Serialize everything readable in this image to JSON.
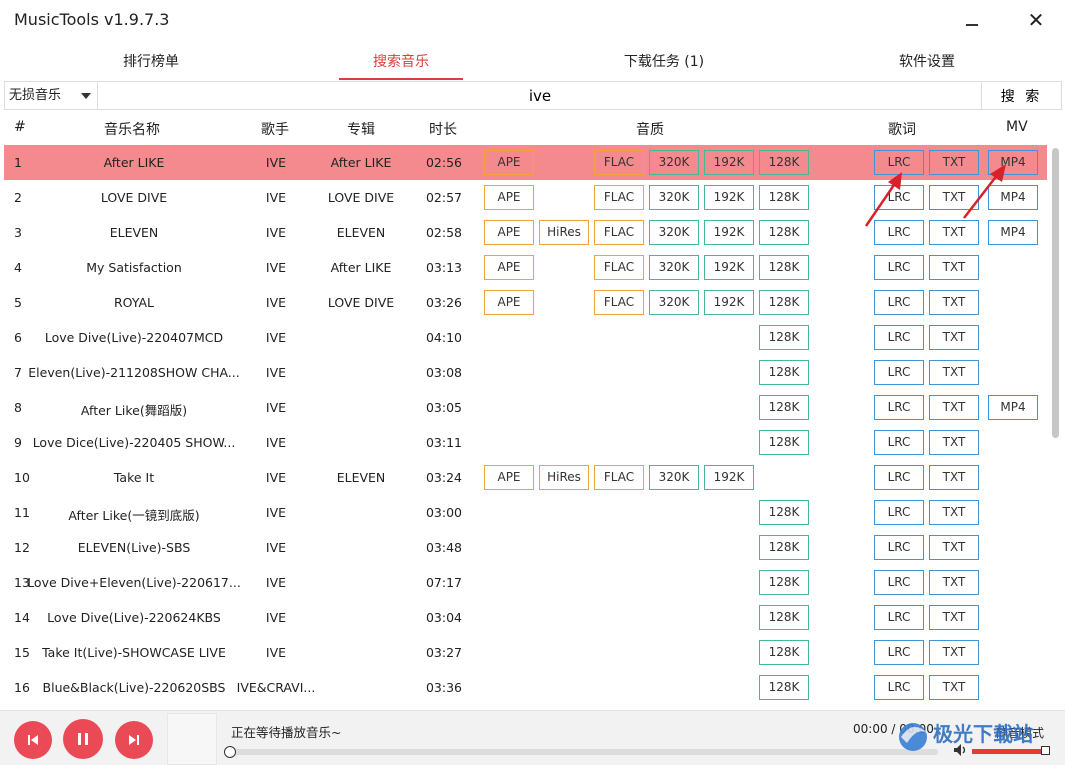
{
  "app": {
    "title": "MusicTools v1.9.7.3"
  },
  "tabs": [
    {
      "label": "排行榜单",
      "active": false
    },
    {
      "label": "搜索音乐",
      "active": true
    },
    {
      "label": "下载任务 (1)",
      "active": false
    },
    {
      "label": "软件设置",
      "active": false
    }
  ],
  "search": {
    "source": "无损音乐",
    "query": "ive",
    "button": "搜 索"
  },
  "table": {
    "headers": {
      "num": "#",
      "name": "音乐名称",
      "artist": "歌手",
      "album": "专辑",
      "duration": "时长",
      "quality": "音质",
      "lyrics": "歌词",
      "mv": "MV"
    },
    "rows": [
      {
        "num": "1",
        "name": "After LIKE",
        "artist": "IVE",
        "album": "After LIKE",
        "duration": "02:56",
        "ape": "APE",
        "hires": "",
        "flac": "FLAC",
        "k320": "320K",
        "k192": "192K",
        "k128": "128K",
        "lrc": "LRC",
        "txt": "TXT",
        "mp4": "MP4",
        "selected": true
      },
      {
        "num": "2",
        "name": "LOVE DIVE",
        "artist": "IVE",
        "album": "LOVE DIVE",
        "duration": "02:57",
        "ape": "APE",
        "hires": "",
        "flac": "FLAC",
        "k320": "320K",
        "k192": "192K",
        "k128": "128K",
        "lrc": "LRC",
        "txt": "TXT",
        "mp4": "MP4"
      },
      {
        "num": "3",
        "name": "ELEVEN",
        "artist": "IVE",
        "album": "ELEVEN",
        "duration": "02:58",
        "ape": "APE",
        "hires": "HiRes",
        "flac": "FLAC",
        "k320": "320K",
        "k192": "192K",
        "k128": "128K",
        "lrc": "LRC",
        "txt": "TXT",
        "mp4": "MP4"
      },
      {
        "num": "4",
        "name": "My Satisfaction",
        "artist": "IVE",
        "album": "After LIKE",
        "duration": "03:13",
        "ape": "APE",
        "hires": "",
        "flac": "FLAC",
        "k320": "320K",
        "k192": "192K",
        "k128": "128K",
        "lrc": "LRC",
        "txt": "TXT",
        "mp4": ""
      },
      {
        "num": "5",
        "name": "ROYAL",
        "artist": "IVE",
        "album": "LOVE DIVE",
        "duration": "03:26",
        "ape": "APE",
        "hires": "",
        "flac": "FLAC",
        "k320": "320K",
        "k192": "192K",
        "k128": "128K",
        "lrc": "LRC",
        "txt": "TXT",
        "mp4": ""
      },
      {
        "num": "6",
        "name": "Love Dive(Live)-220407MCD",
        "artist": "IVE",
        "album": "",
        "duration": "04:10",
        "ape": "",
        "hires": "",
        "flac": "",
        "k320": "",
        "k192": "",
        "k128": "128K",
        "lrc": "LRC",
        "txt": "TXT",
        "mp4": ""
      },
      {
        "num": "7",
        "name": "Eleven(Live)-211208SHOW CHA...",
        "artist": "IVE",
        "album": "",
        "duration": "03:08",
        "ape": "",
        "hires": "",
        "flac": "",
        "k320": "",
        "k192": "",
        "k128": "128K",
        "lrc": "LRC",
        "txt": "TXT",
        "mp4": ""
      },
      {
        "num": "8",
        "name": "After Like(舞蹈版)",
        "artist": "IVE",
        "album": "",
        "duration": "03:05",
        "ape": "",
        "hires": "",
        "flac": "",
        "k320": "",
        "k192": "",
        "k128": "128K",
        "lrc": "LRC",
        "txt": "TXT",
        "mp4": "MP4"
      },
      {
        "num": "9",
        "name": "Love Dice(Live)-220405 SHOW...",
        "artist": "IVE",
        "album": "",
        "duration": "03:11",
        "ape": "",
        "hires": "",
        "flac": "",
        "k320": "",
        "k192": "",
        "k128": "128K",
        "lrc": "LRC",
        "txt": "TXT",
        "mp4": ""
      },
      {
        "num": "10",
        "name": "Take It",
        "artist": "IVE",
        "album": "ELEVEN",
        "duration": "03:24",
        "ape": "APE",
        "hires": "HiRes",
        "flac": "FLAC",
        "k320": "320K",
        "k192": "192K",
        "k128": "",
        "lrc": "LRC",
        "txt": "TXT",
        "mp4": ""
      },
      {
        "num": "11",
        "name": "After Like(一镜到底版)",
        "artist": "IVE",
        "album": "",
        "duration": "03:00",
        "ape": "",
        "hires": "",
        "flac": "",
        "k320": "",
        "k192": "",
        "k128": "128K",
        "lrc": "LRC",
        "txt": "TXT",
        "mp4": ""
      },
      {
        "num": "12",
        "name": "ELEVEN(Live)-SBS",
        "artist": "IVE",
        "album": "",
        "duration": "03:48",
        "ape": "",
        "hires": "",
        "flac": "",
        "k320": "",
        "k192": "",
        "k128": "128K",
        "lrc": "LRC",
        "txt": "TXT",
        "mp4": ""
      },
      {
        "num": "13",
        "name": "Love Dive+Eleven(Live)-220617...",
        "artist": "IVE",
        "album": "",
        "duration": "07:17",
        "ape": "",
        "hires": "",
        "flac": "",
        "k320": "",
        "k192": "",
        "k128": "128K",
        "lrc": "LRC",
        "txt": "TXT",
        "mp4": ""
      },
      {
        "num": "14",
        "name": "Love Dive(Live)-220624KBS",
        "artist": "IVE",
        "album": "",
        "duration": "03:04",
        "ape": "",
        "hires": "",
        "flac": "",
        "k320": "",
        "k192": "",
        "k128": "128K",
        "lrc": "LRC",
        "txt": "TXT",
        "mp4": ""
      },
      {
        "num": "15",
        "name": "Take It(Live)-SHOWCASE LIVE",
        "artist": "IVE",
        "album": "",
        "duration": "03:27",
        "ape": "",
        "hires": "",
        "flac": "",
        "k320": "",
        "k192": "",
        "k128": "128K",
        "lrc": "LRC",
        "txt": "TXT",
        "mp4": ""
      },
      {
        "num": "16",
        "name": "Blue&Black(Live)-220620SBS",
        "artist": "IVE&CRAVI...",
        "album": "",
        "duration": "03:36",
        "ape": "",
        "hires": "",
        "flac": "",
        "k320": "",
        "k192": "",
        "k128": "128K",
        "lrc": "LRC",
        "txt": "TXT",
        "mp4": ""
      }
    ]
  },
  "player": {
    "status": "正在等待播放音乐~",
    "time": "00:00 / 00:00",
    "mute_label": "静音模式",
    "progress": 0,
    "volume": 1.0
  },
  "watermark": {
    "text": "极光下载站"
  },
  "colors": {
    "accent": "#e23b3b",
    "selected_row": "#f48a8d",
    "lossless": "#f0a33a",
    "lossy": "#46b89a",
    "lyrics": "#3e96d8",
    "player_button": "#ea4a55"
  },
  "icons": [
    "minimize-icon",
    "close-icon",
    "dropdown-caret-icon",
    "previous-icon",
    "pause-icon",
    "next-icon",
    "volume-icon"
  ]
}
